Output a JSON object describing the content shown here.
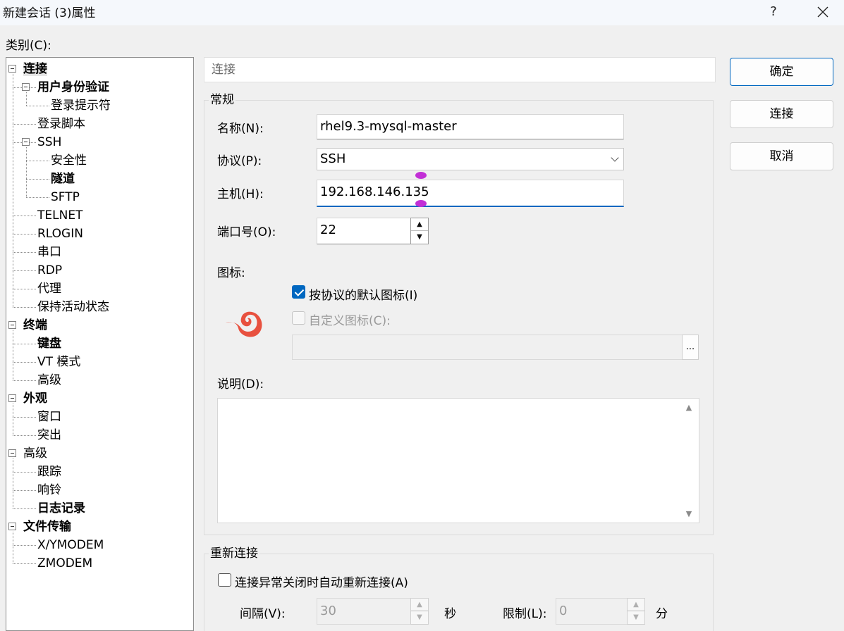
{
  "window": {
    "title": "新建会话 (3)属性",
    "help": "?",
    "close": "✕"
  },
  "category_label": "类别(C):",
  "tree": [
    {
      "label": "连接",
      "bold": true,
      "selected": true,
      "level": 0,
      "expander": true
    },
    {
      "label": "用户身份验证",
      "bold": true,
      "level": 1,
      "expander": true
    },
    {
      "label": "登录提示符",
      "level": 2
    },
    {
      "label": "登录脚本",
      "level": 1
    },
    {
      "label": "SSH",
      "level": 1,
      "expander": true
    },
    {
      "label": "安全性",
      "level": 2
    },
    {
      "label": "隧道",
      "bold": true,
      "level": 2
    },
    {
      "label": "SFTP",
      "level": 2
    },
    {
      "label": "TELNET",
      "level": 1
    },
    {
      "label": "RLOGIN",
      "level": 1
    },
    {
      "label": "串口",
      "level": 1
    },
    {
      "label": "RDP",
      "level": 1
    },
    {
      "label": "代理",
      "level": 1
    },
    {
      "label": "保持活动状态",
      "level": 1
    },
    {
      "label": "终端",
      "bold": true,
      "level": 0,
      "expander": true
    },
    {
      "label": "键盘",
      "bold": true,
      "level": 1
    },
    {
      "label": "VT 模式",
      "level": 1
    },
    {
      "label": "高级",
      "level": 1
    },
    {
      "label": "外观",
      "bold": true,
      "level": 0,
      "expander": true
    },
    {
      "label": "窗口",
      "level": 1
    },
    {
      "label": "突出",
      "level": 1
    },
    {
      "label": "高级",
      "level": 0,
      "expander": true
    },
    {
      "label": "跟踪",
      "level": 1
    },
    {
      "label": "响铃",
      "level": 1
    },
    {
      "label": "日志记录",
      "bold": true,
      "level": 1
    },
    {
      "label": "文件传输",
      "bold": true,
      "level": 0,
      "expander": true
    },
    {
      "label": "X/YMODEM",
      "level": 1
    },
    {
      "label": "ZMODEM",
      "level": 1
    }
  ],
  "section_header": "连接",
  "general": {
    "title": "常规",
    "name_label": "名称(N):",
    "name_value": "rhel9.3-mysql-master",
    "protocol_label": "协议(P):",
    "protocol_value": "SSH",
    "host_label": "主机(H):",
    "host_value": "192.168.146.135",
    "port_label": "端口号(O):",
    "port_value": "22",
    "icon_label": "图标:",
    "default_icon_label": "按协议的默认图标(I)",
    "default_icon_checked": true,
    "custom_icon_label": "自定义图标(C):",
    "custom_icon_checked": false,
    "browse_label": "...",
    "description_label": "说明(D):"
  },
  "reconnect": {
    "title": "重新连接",
    "auto_label": "连接异常关闭时自动重新连接(A)",
    "auto_checked": false,
    "interval_label": "间隔(V):",
    "interval_value": "30",
    "interval_unit": "秒",
    "limit_label": "限制(L):",
    "limit_value": "0",
    "limit_unit": "分"
  },
  "buttons": {
    "ok": "确定",
    "connect": "连接",
    "cancel": "取消"
  },
  "colors": {
    "accent": "#0067c0",
    "protocol_icon": "#e8513f"
  },
  "icons": {
    "protocol_icon": "xshell-swirl-icon"
  }
}
